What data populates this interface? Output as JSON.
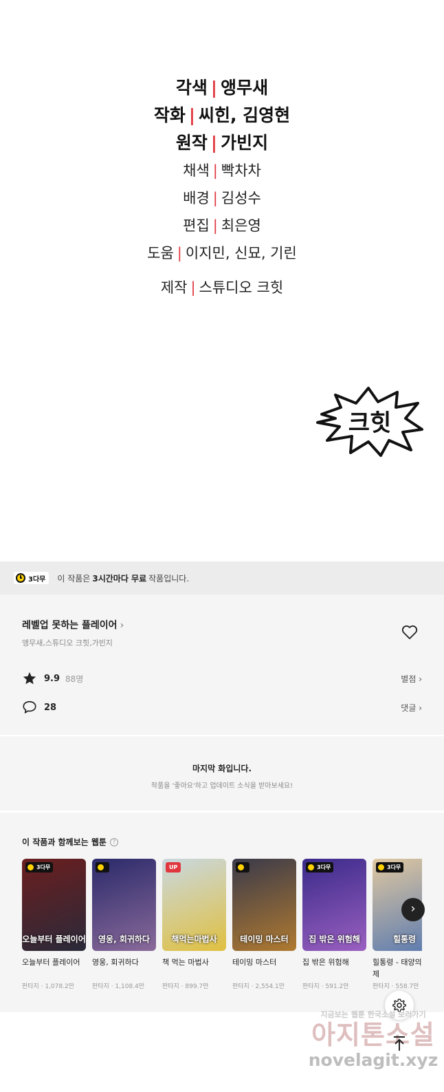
{
  "credits": [
    {
      "role": "각색",
      "names": "앵무새"
    },
    {
      "role": "작화",
      "names": "씨힌, 김영현"
    },
    {
      "role": "원작",
      "names": "가빈지"
    },
    {
      "role": "채색",
      "names": "빡차차"
    },
    {
      "role": "배경",
      "names": "김성수"
    },
    {
      "role": "편집",
      "names": "최은영"
    },
    {
      "role": "도움",
      "names": "이지민, 신묘, 기린"
    },
    {
      "role": "제작",
      "names": "스튜디오 크힛"
    }
  ],
  "credit_separator": "|",
  "logo_text": "크힛",
  "free_banner": {
    "badge": "3다무",
    "prefix": "이 작품은",
    "bold": "3시간마다 무료",
    "suffix": "작품입니다."
  },
  "work": {
    "title": "레벨업 못하는 플레이어",
    "title_chevron": "›",
    "authors": "앵무새,스튜디오 크힛,가빈지",
    "rating": "9.9",
    "rating_count": "88명",
    "rating_link": "별점 ›",
    "comments": "28",
    "comments_link": "댓글 ›"
  },
  "last_episode": {
    "heading": "마지막 화입니다.",
    "sub": "작품을 '좋아요'하고 업데이트 소식을 받아보세요!"
  },
  "recommend": {
    "heading": "이 작품과 함께보는 웹툰",
    "help": "?",
    "next": "›",
    "items": [
      {
        "name": "오늘부터 플레이어",
        "meta": "판타지 · 1,078.2만",
        "badge": "3다무",
        "badge_type": "wait",
        "cover_text": "오늘부터 플레이어",
        "c1": "#6b1e1e",
        "c2": "#2a2a3a"
      },
      {
        "name": "영웅, 회귀하다",
        "meta": "판타지 · 1,108.4만",
        "badge": "",
        "badge_type": "wait",
        "cover_text": "영웅, 회귀하다",
        "c1": "#2a2a6a",
        "c2": "#8a6a9a"
      },
      {
        "name": "책 먹는 마법사",
        "meta": "판타지 · 899.7만",
        "badge": "UP",
        "badge_type": "up",
        "cover_text": "책먹는마법사",
        "c1": "#c9d8e0",
        "c2": "#e0c040"
      },
      {
        "name": "테이밍 마스터",
        "meta": "판타지 · 2,554.1만",
        "badge": "",
        "badge_type": "wait",
        "cover_text": "테이밍 마스터",
        "c1": "#3a3a4a",
        "c2": "#b07a30"
      },
      {
        "name": "집 밖은 위험해",
        "meta": "판타지 · 591.2만",
        "badge": "3다무",
        "badge_type": "wait",
        "cover_text": "집 밖은 위험해",
        "c1": "#3a2a8a",
        "c2": "#9a60c0"
      },
      {
        "name": "힐통령 - 태양의 사제",
        "meta": "판타지 · 558.7만",
        "badge": "3다무",
        "badge_type": "wait",
        "cover_text": "힐통령",
        "c1": "#e0c8a0",
        "c2": "#5a7ab0"
      }
    ]
  },
  "watermark": {
    "line1": "지금보는 웹툰 한국소설 보러가기",
    "line2": "아지톤소설",
    "line3": "novelagit.xyz"
  },
  "icons": {
    "heart": "heart-icon",
    "star": "star-icon",
    "comment": "comment-icon",
    "gear": "gear-icon",
    "top": "arrow-up-icon",
    "clock": "clock-icon"
  },
  "colors": {
    "accent_red": "#e0373f",
    "badge_yellow": "#ffd200"
  }
}
